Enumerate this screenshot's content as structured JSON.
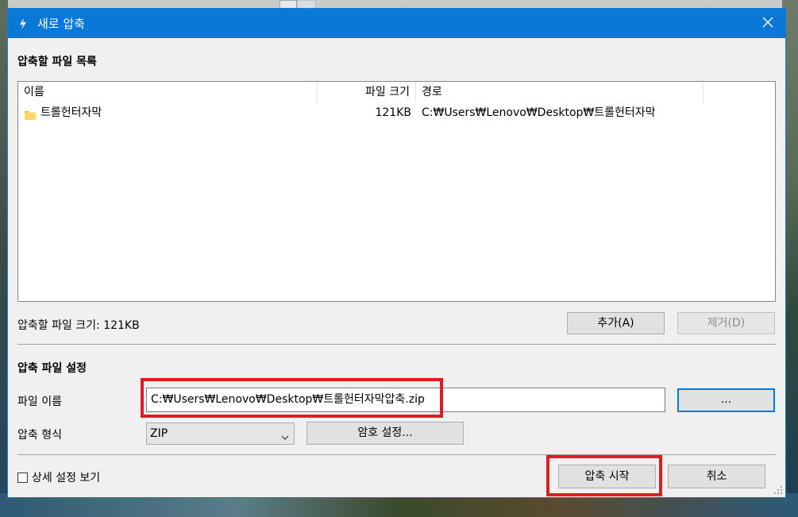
{
  "window": {
    "title": "새로 압축",
    "title_icon": "app-bolt-icon",
    "close_icon": "close-icon",
    "accent_color": "#0a78d7"
  },
  "file_list": {
    "heading": "압축할 파일 목록",
    "columns": [
      "이름",
      "파일 크기",
      "경로"
    ],
    "rows": [
      {
        "name": "트롤헌터자막",
        "size": "121KB",
        "path": "C:₩Users₩Lenovo₩Desktop₩트롤헌터자막",
        "icon": "folder-icon"
      }
    ],
    "total_label": "압축할 파일 크기: 121KB",
    "add_button": "추가(A)",
    "remove_button": "제거(D)"
  },
  "settings": {
    "heading": "압축 파일 설정",
    "filename_label": "파일 이름",
    "filename_value": "C:₩Users₩Lenovo₩Desktop₩트롤헌터자막압축.zip",
    "browse_button": "...",
    "format_label": "압축 형식",
    "format_value": "ZIP",
    "password_button": "암호 설정..."
  },
  "footer": {
    "details_checkbox": "상세 설정 보기",
    "details_checked": false,
    "start_button": "압축 시작",
    "cancel_button": "취소"
  },
  "highlight_color": "#e01b24"
}
